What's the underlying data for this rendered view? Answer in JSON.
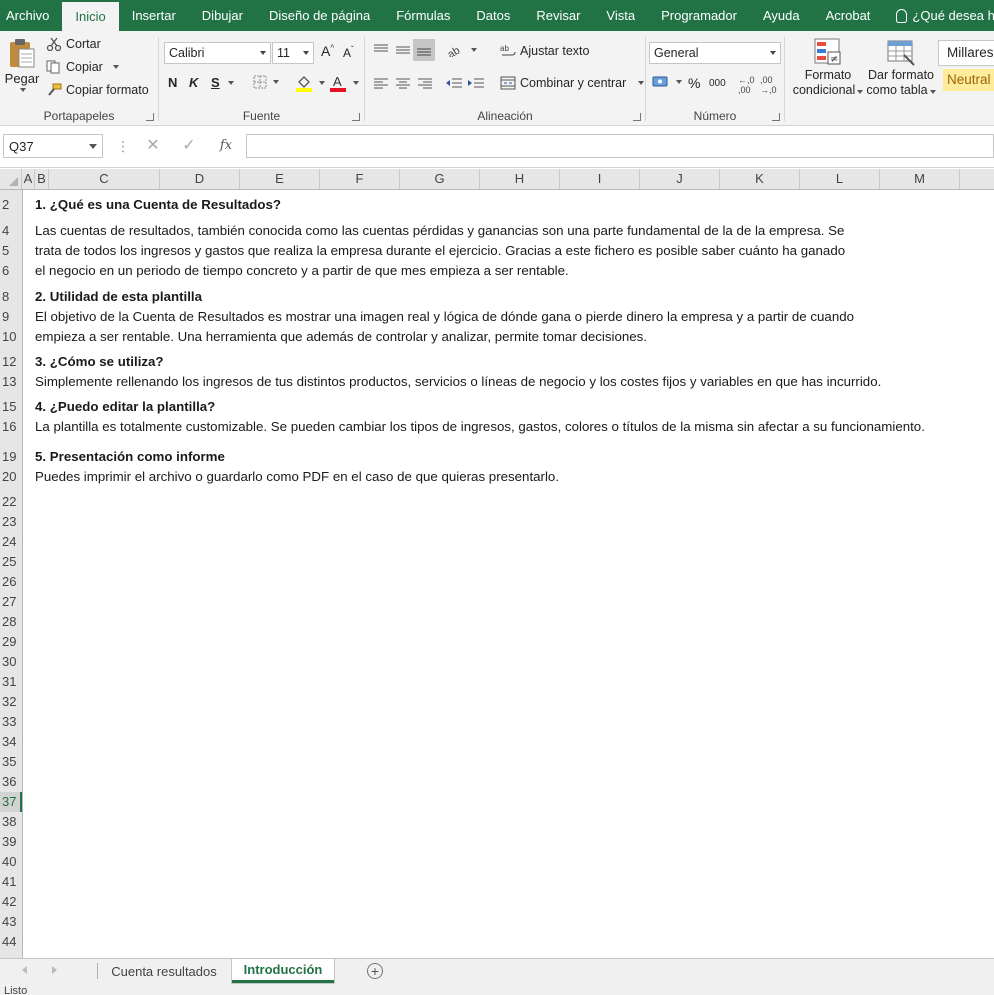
{
  "menu": {
    "tabs": [
      "Archivo",
      "Inicio",
      "Insertar",
      "Dibujar",
      "Diseño de página",
      "Fórmulas",
      "Datos",
      "Revisar",
      "Vista",
      "Programador",
      "Ayuda",
      "Acrobat"
    ],
    "active_tab": "Inicio",
    "tell_me": "¿Qué desea hacer?"
  },
  "ribbon": {
    "clipboard": {
      "paste": "Pegar",
      "cut": "Cortar",
      "copy": "Copiar",
      "format_painter": "Copiar formato",
      "label": "Portapapeles"
    },
    "font": {
      "name": "Calibri",
      "size": "11",
      "bold": "N",
      "italic": "K",
      "underline": "S",
      "label": "Fuente",
      "fill_color": "#ffff00",
      "text_color": "#e81123"
    },
    "alignment": {
      "wrap_text": "Ajustar texto",
      "merge_center": "Combinar y centrar",
      "label": "Alineación"
    },
    "number": {
      "format": "General",
      "percent": "%",
      "thousands": "000",
      "label": "Número"
    },
    "styles": {
      "conditional_line1": "Formato",
      "conditional_line2": "condicional",
      "table_line1": "Dar formato",
      "table_line2": "como tabla",
      "style_millares": "Millares",
      "style_neutral": "Neutral",
      "neutral_color": "#ffeb9c"
    }
  },
  "formula_bar": {
    "name_box": "Q37",
    "cancel_icon": "✕",
    "enter_icon": "✓",
    "fx": "fx",
    "content": ""
  },
  "columns": [
    "A",
    "B",
    "C",
    "D",
    "E",
    "F",
    "G",
    "H",
    "I",
    "J",
    "K",
    "L",
    "M"
  ],
  "rows": [
    "2",
    "4",
    "5",
    "6",
    "8",
    "9",
    "10",
    "12",
    "13",
    "15",
    "16",
    "19",
    "20",
    "22",
    "23",
    "24",
    "25",
    "26",
    "27",
    "28",
    "29",
    "30",
    "31",
    "32",
    "33",
    "34",
    "35",
    "36",
    "37",
    "38",
    "39",
    "40",
    "41",
    "42",
    "43",
    "44"
  ],
  "selected_row": "37",
  "content": {
    "h1": "1.  ¿Qué es una Cuenta de Resultados?",
    "p1_1": "Las cuentas de resultados, también conocida como las cuentas pérdidas y ganancias son una parte fundamental de la  de la empresa. Se",
    "p1_2": "trata de todos los ingresos y gastos que realiza la empresa durante el ejercicio. Gracias a este fichero es posible saber cuánto ha ganado",
    "p1_3": "el negocio en un periodo de tiempo concreto y a partir de que mes empieza a ser rentable.",
    "h2": "2.  Utilidad de esta plantilla",
    "p2_1": "El objetivo de la Cuenta de Resultados es mostrar una imagen real y lógica de dónde gana o pierde dinero la empresa y a partir de cuando",
    "p2_2": "empieza a ser rentable. Una herramienta que además de controlar y analizar, permite tomar decisiones.",
    "h3": "3.  ¿Cómo se utiliza?",
    "p3_1": "Simplemente rellenando los ingresos de tus distintos productos, servicios o líneas de negocio y los costes fijos y variables en que has incurrido.",
    "h4": "4.  ¿Puedo editar la plantilla?",
    "p4_1": "La plantilla es totalmente customizable. Se pueden cambiar los tipos de ingresos, gastos, colores o títulos de la misma sin afectar a su funcionamiento.",
    "h5": "5.  Presentación como informe",
    "p5_1": "Puedes imprimir el archivo o guardarlo como PDF en el caso de que quieras presentarlo."
  },
  "sheets": {
    "tab1": "Cuenta resultados",
    "tab2": "Introducción",
    "active": "Introducción"
  },
  "status": {
    "text": "Listo"
  },
  "theme": {
    "accent": "#217346"
  }
}
